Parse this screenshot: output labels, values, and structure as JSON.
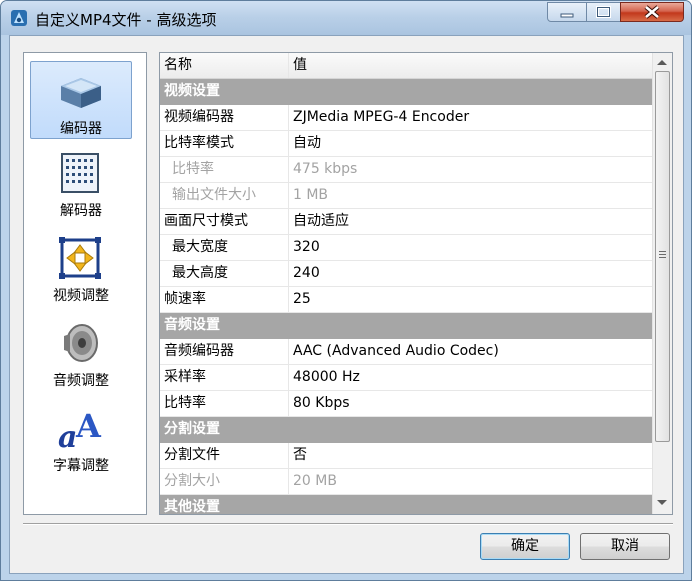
{
  "window": {
    "title": "自定义MP4文件 - 高级选项"
  },
  "nav": [
    {
      "label": "编码器",
      "icon": "encoder-box-icon",
      "selected": true
    },
    {
      "label": "解码器",
      "icon": "decoder-chip-icon",
      "selected": false
    },
    {
      "label": "视频调整",
      "icon": "video-resize-icon",
      "selected": false
    },
    {
      "label": "音频调整",
      "icon": "speaker-icon",
      "selected": false
    },
    {
      "label": "字幕调整",
      "icon": "subtitle-font-icon",
      "selected": false
    }
  ],
  "grid": {
    "header": {
      "name": "名称",
      "value": "值"
    },
    "rows": [
      {
        "type": "group",
        "name": "视频设置"
      },
      {
        "type": "item",
        "name": "视频编码器",
        "value": "ZJMedia MPEG-4 Encoder"
      },
      {
        "type": "item",
        "name": "比特率模式",
        "value": "自动"
      },
      {
        "type": "item",
        "name": "比特率",
        "value": "475 kbps",
        "indent": true,
        "disabled": true
      },
      {
        "type": "item",
        "name": "输出文件大小",
        "value": "1 MB",
        "indent": true,
        "disabled": true
      },
      {
        "type": "item",
        "name": "画面尺寸模式",
        "value": "自动适应"
      },
      {
        "type": "item",
        "name": "最大宽度",
        "value": "320",
        "indent": true
      },
      {
        "type": "item",
        "name": "最大高度",
        "value": "240",
        "indent": true
      },
      {
        "type": "item",
        "name": "帧速率",
        "value": "25"
      },
      {
        "type": "group",
        "name": "音频设置"
      },
      {
        "type": "item",
        "name": "音频编码器",
        "value": "AAC (Advanced Audio Codec)"
      },
      {
        "type": "item",
        "name": "采样率",
        "value": "48000 Hz"
      },
      {
        "type": "item",
        "name": "比特率",
        "value": "80 Kbps"
      },
      {
        "type": "group",
        "name": "分割设置"
      },
      {
        "type": "item",
        "name": "分割文件",
        "value": "否"
      },
      {
        "type": "item",
        "name": "分割大小",
        "value": "20 MB",
        "disabled": true
      },
      {
        "type": "group",
        "name": "其他设置"
      }
    ]
  },
  "buttons": {
    "ok": "确定",
    "cancel": "取消"
  }
}
